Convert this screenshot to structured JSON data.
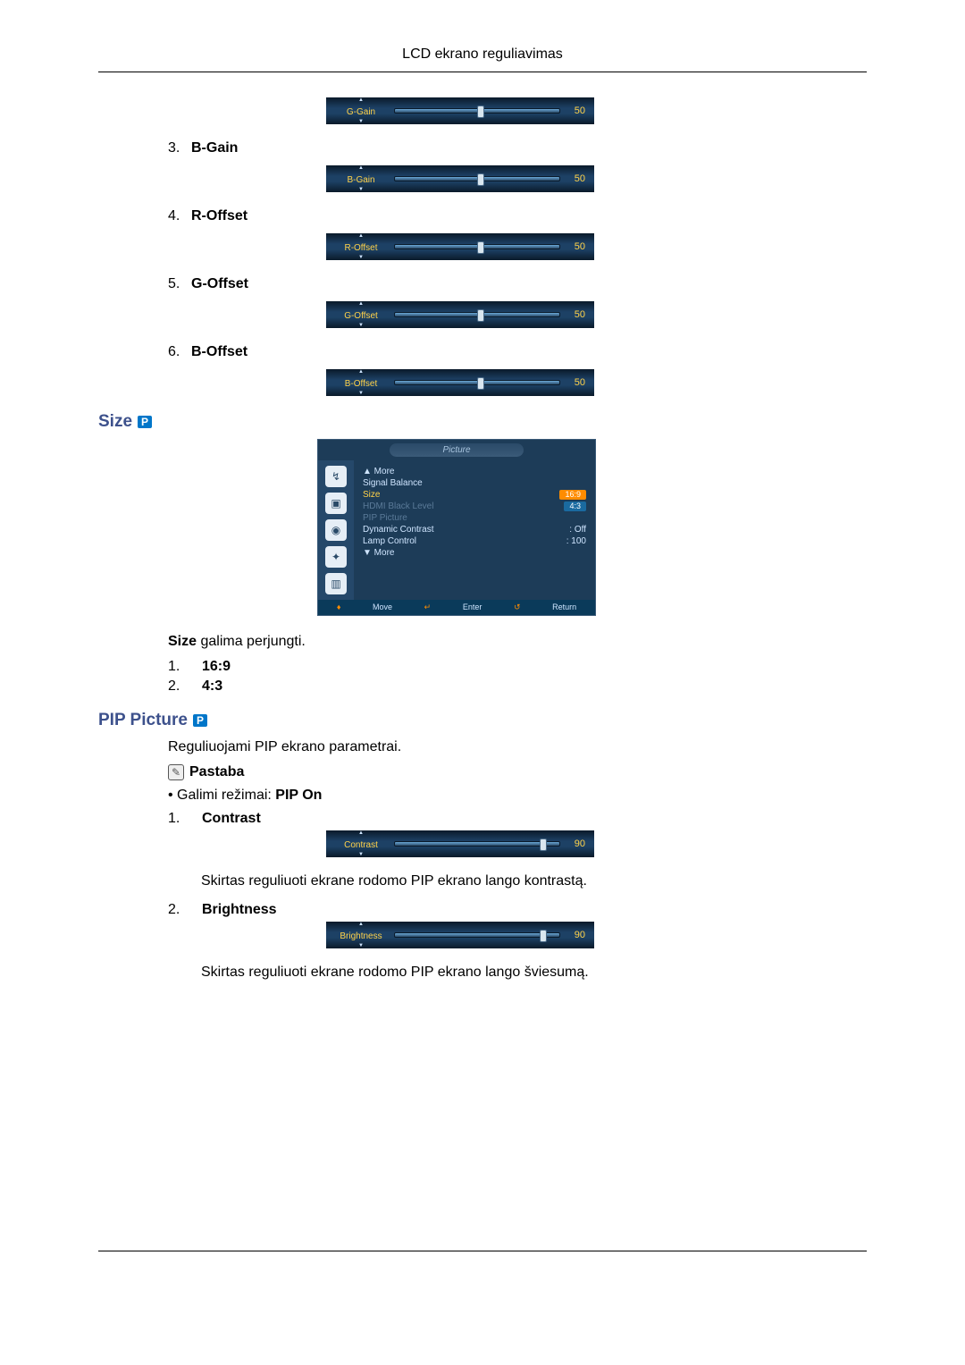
{
  "header": "LCD ekrano reguliavimas",
  "sliders": [
    {
      "name": "G-Gain",
      "value": 50,
      "pos": 50
    },
    {
      "name": "B-Gain",
      "value": 50,
      "pos": 50
    },
    {
      "name": "R-Offset",
      "value": 50,
      "pos": 50
    },
    {
      "name": "G-Offset",
      "value": 50,
      "pos": 50
    },
    {
      "name": "B-Offset",
      "value": 50,
      "pos": 50
    },
    {
      "name": "Contrast",
      "value": 90,
      "pos": 90
    },
    {
      "name": "Brightness",
      "value": 90,
      "pos": 90
    }
  ],
  "gain_labels": {
    "n3": "3.",
    "l3": "B-Gain",
    "n4": "4.",
    "l4": "R-Offset",
    "n5": "5.",
    "l5": "G-Offset",
    "n6": "6.",
    "l6": "B-Offset"
  },
  "size_section": {
    "title": "Size",
    "badge": "P",
    "osd": {
      "title": "Picture",
      "more_top": "▲ More",
      "items": [
        {
          "label": "Signal Balance",
          "value": ""
        },
        {
          "label": "Size",
          "value": "16:9",
          "sel": true
        },
        {
          "label": "HDMI Black Level",
          "value": "4:3",
          "sel2": true,
          "dim": true
        },
        {
          "label": "PIP Picture",
          "value": "",
          "dim": true
        },
        {
          "label": "Dynamic Contrast",
          "value": ": Off"
        },
        {
          "label": "Lamp Control",
          "value": ": 100"
        }
      ],
      "more_bottom": "▼ More",
      "footer": {
        "move": "Move",
        "enter": "Enter",
        "return": "Return"
      }
    },
    "desc_prefix": "Size",
    "desc_rest": " galima perjungti.",
    "opt1_n": "1.",
    "opt1": "16:9",
    "opt2_n": "2.",
    "opt2": "4:3"
  },
  "pip_section": {
    "title": "PIP Picture",
    "badge": "P",
    "desc": "Reguliuojami PIP ekrano parametrai.",
    "note": "Pastaba",
    "mode_prefix": "Galimi režimai: ",
    "mode_bold": "PIP On",
    "c_n": "1.",
    "c_label": "Contrast",
    "c_desc": "Skirtas reguliuoti ekrane rodomo PIP ekrano lango kontrastą.",
    "b_n": "2.",
    "b_label": "Brightness",
    "b_desc": "Skirtas reguliuoti ekrane rodomo PIP ekrano lango šviesumą."
  }
}
